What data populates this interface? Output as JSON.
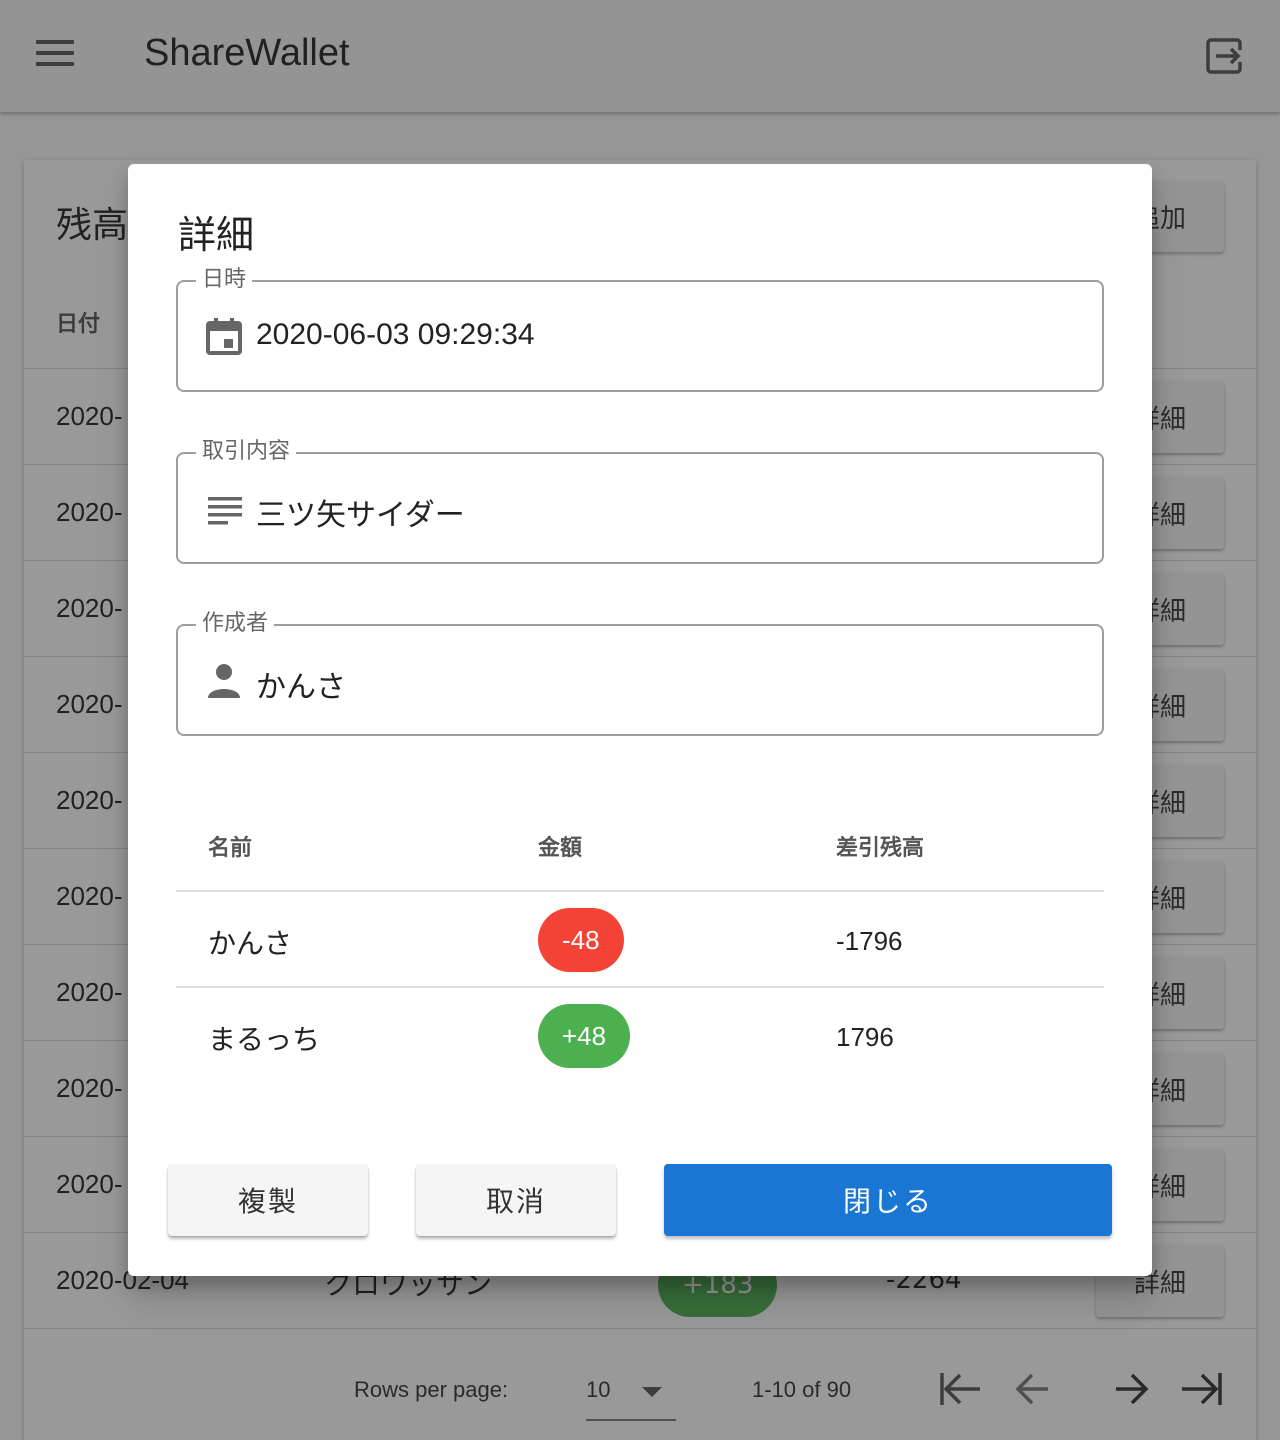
{
  "appbar": {
    "title": "ShareWallet",
    "menu_icon": "menu-icon",
    "logout_icon": "logout-icon"
  },
  "background": {
    "card_title": "残高",
    "add_label": "追加",
    "col_date": "日付",
    "row_dates": [
      "2020-",
      "2020-",
      "2020-",
      "2020-",
      "2020-",
      "2020-",
      "2020-",
      "2020-",
      "2020-"
    ],
    "detail_label": "詳細",
    "last_row": {
      "date": "2020-02-04",
      "desc": "クロワッサン",
      "amount": "+183",
      "balance": "-2264",
      "detail": "詳細"
    },
    "footer": {
      "rows_per_page_label": "Rows per page:",
      "rows_per_page_value": "10",
      "range": "1-10 of 90"
    }
  },
  "dialog": {
    "title": "詳細",
    "datetime": {
      "label": "日時",
      "value": "2020-06-03 09:29:34",
      "icon": "calendar-icon"
    },
    "description": {
      "label": "取引内容",
      "value": "三ツ矢サイダー",
      "icon": "notes-icon"
    },
    "author": {
      "label": "作成者",
      "value": "かんさ",
      "icon": "person-icon"
    },
    "table": {
      "headers": {
        "name": "名前",
        "amount": "金額",
        "balance": "差引残高"
      },
      "rows": [
        {
          "name": "かんさ",
          "amount": "-48",
          "balance": "-1796",
          "color": "#f44336"
        },
        {
          "name": "まるっち",
          "amount": "+48",
          "balance": "1796",
          "color": "#4caf50"
        }
      ]
    },
    "buttons": {
      "duplicate": "複製",
      "cancel": "取消",
      "close": "閉じる"
    }
  },
  "colors": {
    "primary": "#1976d2",
    "negative": "#f44336",
    "positive": "#4caf50"
  }
}
